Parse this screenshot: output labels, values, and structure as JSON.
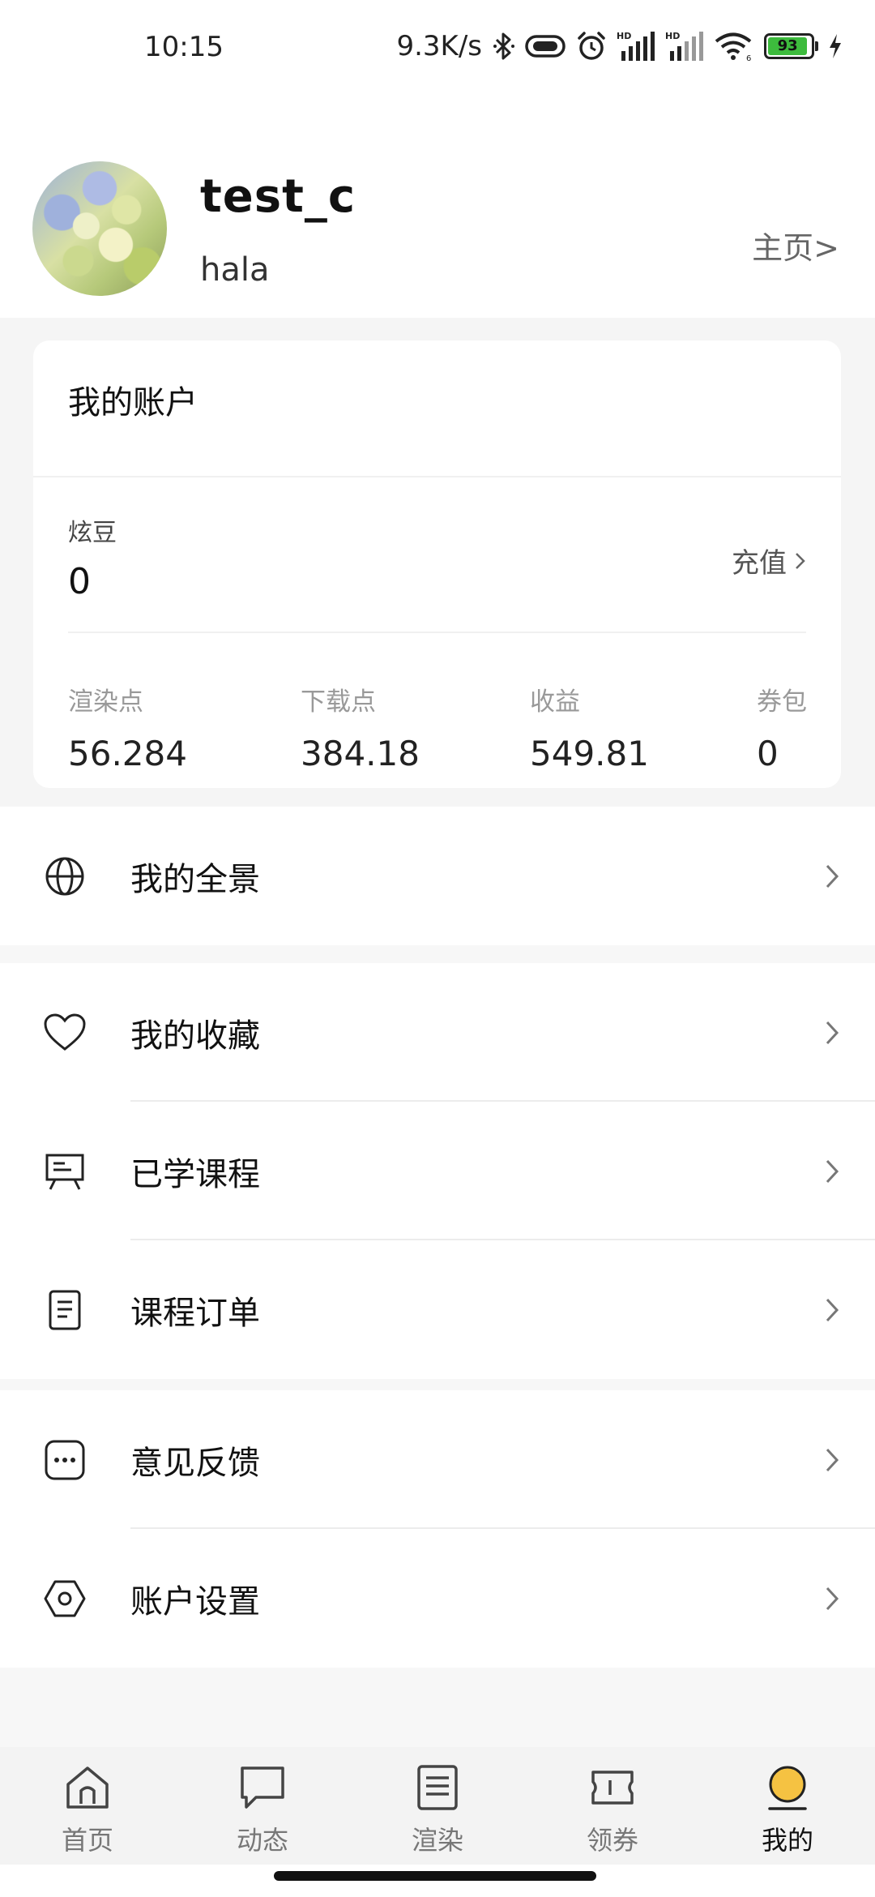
{
  "status_bar": {
    "time": "10:15",
    "net_speed": "9.3K/s",
    "battery": "93",
    "icons": [
      "bluetooth-icon",
      "vibrate-icon",
      "alarm-icon",
      "signal-hd-icon",
      "signal-hd-icon",
      "wifi-icon",
      "battery-icon",
      "charging-icon"
    ]
  },
  "profile": {
    "username": "test_c",
    "bio": "hala",
    "homepage_link": "主页>"
  },
  "account": {
    "title": "我的账户",
    "bean_label": "炫豆",
    "bean_value": "0",
    "recharge_label": "充值",
    "stats": [
      {
        "label": "渲染点",
        "value": "56.284"
      },
      {
        "label": "下载点",
        "value": "384.18"
      },
      {
        "label": "收益",
        "value": "549.81"
      },
      {
        "label": "券包",
        "value": "0"
      }
    ]
  },
  "menu": {
    "group1": [
      {
        "label": "我的全景",
        "icon": "globe-icon"
      }
    ],
    "group2": [
      {
        "label": "我的收藏",
        "icon": "heart-icon"
      },
      {
        "label": "已学课程",
        "icon": "presentation-board-icon"
      },
      {
        "label": "课程订单",
        "icon": "document-icon"
      }
    ],
    "group3": [
      {
        "label": "意见反馈",
        "icon": "chat-dots-icon"
      },
      {
        "label": "账户设置",
        "icon": "hexagon-settings-icon"
      }
    ]
  },
  "tabs": [
    {
      "label": "首页",
      "icon": "home-icon",
      "active": false
    },
    {
      "label": "动态",
      "icon": "message-icon",
      "active": false
    },
    {
      "label": "渲染",
      "icon": "list-icon",
      "active": false
    },
    {
      "label": "领券",
      "icon": "ticket-icon",
      "active": false
    },
    {
      "label": "我的",
      "icon": "profile-circle-icon",
      "active": true
    }
  ],
  "colors": {
    "accent_active": "#f5c242",
    "battery_green": "#3dbb3d"
  }
}
